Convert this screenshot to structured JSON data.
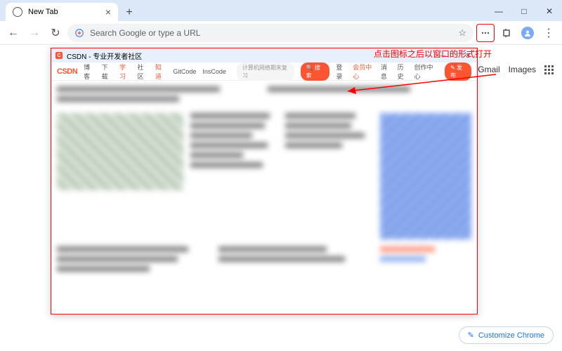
{
  "annotation": "点击图标之后以窗口的形式打开",
  "browser": {
    "tab_title": "New Tab",
    "omnibox_placeholder": "Search Google or type a URL",
    "win_min": "—",
    "win_max": "□",
    "win_close": "✕",
    "shortcuts": {
      "gmail": "Gmail",
      "images": "Images"
    },
    "customize": "Customize Chrome"
  },
  "popup": {
    "title": "CSDN - 专业开发者社区",
    "logo": "CSDN",
    "nav": [
      "博客",
      "下载",
      "学习",
      "社区",
      "知道",
      "GitCode",
      "InsCode"
    ],
    "search_placeholder": "计算机网络期末复习",
    "search_btn": "搜索",
    "right_nav": [
      "登录",
      "会员中心",
      "消息",
      "历史",
      "创作中心"
    ],
    "publish": "发布",
    "logo_mark": "C"
  }
}
